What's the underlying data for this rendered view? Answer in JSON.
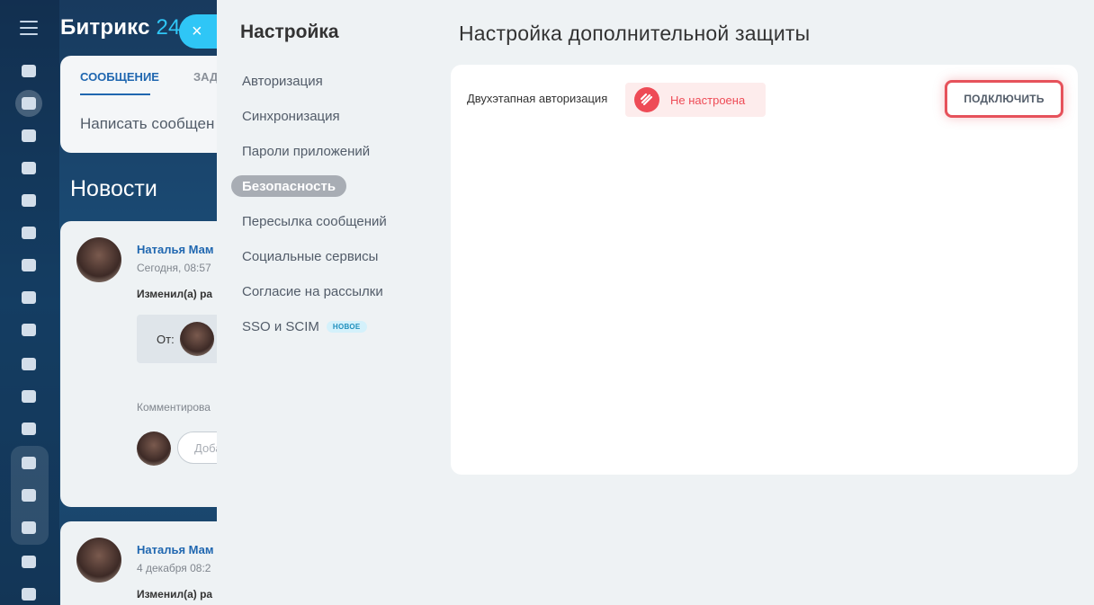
{
  "brand": {
    "name": "Битрикс",
    "number": "24"
  },
  "feed": {
    "tabs": [
      "СООБЩЕНИЕ",
      "ЗАДА"
    ],
    "input_placeholder": "Написать сообщен",
    "news_title": "Новости",
    "posts": [
      {
        "author": "Наталья Мам",
        "date": "Сегодня, 08:57",
        "action": "Изменил(а) ра",
        "from_label": "От:",
        "comments_label": "Комментирова",
        "comment_placeholder": "Доба"
      },
      {
        "author": "Наталья Мам",
        "date": "4 декабря 08:2",
        "action": "Изменил(а) ра"
      }
    ]
  },
  "close_button": {
    "label": "×"
  },
  "settings": {
    "title": "Настройка",
    "menu": [
      {
        "label": "Авторизация",
        "active": false
      },
      {
        "label": "Синхронизация",
        "active": false
      },
      {
        "label": "Пароли приложений",
        "active": false
      },
      {
        "label": "Безопасность",
        "active": true
      },
      {
        "label": "Пересылка сообщений",
        "active": false
      },
      {
        "label": "Социальные сервисы",
        "active": false
      },
      {
        "label": "Согласие на рассылки",
        "active": false
      },
      {
        "label": "SSO и SCIM",
        "active": false,
        "badge": "НОВОЕ"
      }
    ]
  },
  "security": {
    "title": "Настройка дополнительной защиты",
    "two_factor_label": "Двухэтапная авторизация",
    "status_text": "Не настроена",
    "status_icon": "shield-off-icon",
    "connect_button": "ПОДКЛЮЧИТЬ"
  },
  "colors": {
    "accent": "#2fc6f6",
    "link": "#2067b0",
    "status_red": "#ee4b56",
    "status_bg": "#fdecec",
    "button_border": "#e6525b",
    "panel_bg": "#eef2f4"
  }
}
